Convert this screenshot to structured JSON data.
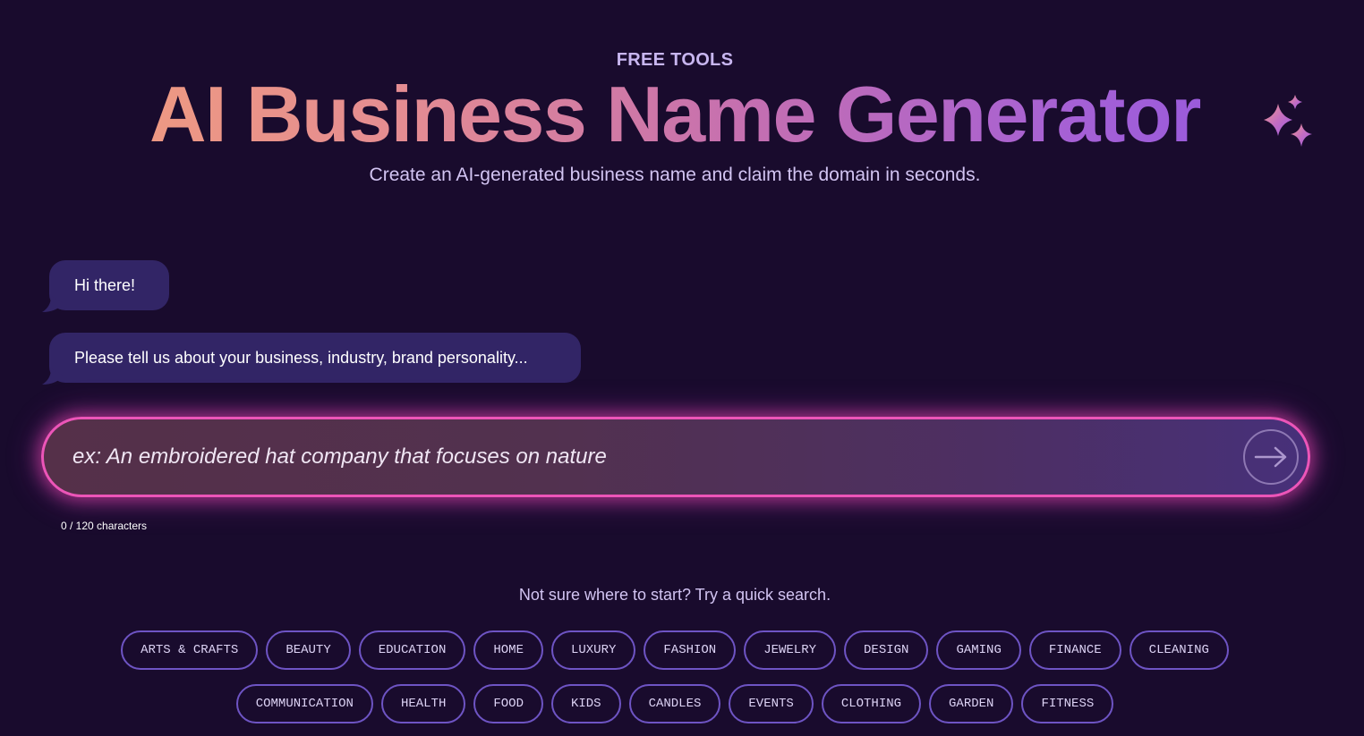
{
  "header": {
    "eyebrow": "FREE TOOLS",
    "title": "AI Business Name Generator",
    "subtitle": "Create an AI-generated business name and claim the domain in seconds.",
    "sparkle_icon": "sparkles-icon"
  },
  "chat": {
    "messages": [
      {
        "text": "Hi there!"
      },
      {
        "text": "Please tell us about your business, industry, brand personality..."
      }
    ]
  },
  "input": {
    "value": "",
    "placeholder": "ex: An embroidered hat company that focuses on nature",
    "char_count": "0 / 120 characters",
    "submit_icon": "arrow-right-icon"
  },
  "quick_search": {
    "prompt": "Not sure where to start? Try a quick search.",
    "row1": [
      "ARTS & CRAFTS",
      "BEAUTY",
      "EDUCATION",
      "HOME",
      "LUXURY",
      "FASHION",
      "JEWELRY",
      "DESIGN",
      "GAMING",
      "FINANCE",
      "CLEANING"
    ],
    "row2": [
      "COMMUNICATION",
      "HEALTH",
      "FOOD",
      "KIDS",
      "CANDLES",
      "EVENTS",
      "CLOTHING",
      "GARDEN",
      "FITNESS"
    ]
  },
  "colors": {
    "background": "#190b2d",
    "bubble": "#322566",
    "accent_pink": "#ec55b8",
    "chip_border": "#6e54c4"
  }
}
